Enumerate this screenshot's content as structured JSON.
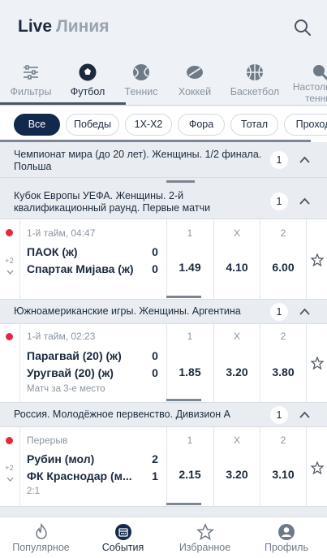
{
  "header": {
    "live_label": "Live",
    "line_label": "Линия",
    "search_icon": "search-icon"
  },
  "sports": [
    {
      "label": "Фильтры",
      "icon": "filters-icon"
    },
    {
      "label": "Футбол",
      "icon": "football-icon",
      "active": true
    },
    {
      "label": "Теннис",
      "icon": "tennis-icon"
    },
    {
      "label": "Хоккей",
      "icon": "hockey-icon"
    },
    {
      "label": "Баскетбол",
      "icon": "basketball-icon"
    },
    {
      "label": "Настольный теннис",
      "icon": "table-tennis-icon"
    }
  ],
  "filters": [
    "Все",
    "Победы",
    "1Х-Х2",
    "Фора",
    "Тотал",
    "Проход"
  ],
  "leagues": [
    {
      "name": "Чемпионат мира (до 20 лет). Женщины. 1/2 финала. Польша",
      "count": "1"
    },
    {
      "name": "Кубок Европы УЕФА. Женщины. 2-й квалификационный раунд. Первые матчи",
      "count": "1"
    },
    {
      "name": "Южноамериканские игры. Женщины. Аргентина",
      "count": "1"
    },
    {
      "name": "Россия. Молодёжное первенство. Дивизион А",
      "count": "1"
    }
  ],
  "odds_headers": [
    "1",
    "X",
    "2"
  ],
  "matches": [
    {
      "status": "1-й тайм, 04:47",
      "team1": "ПАОК (ж)",
      "score1": "0",
      "team2": "Спартак Мијава (ж)",
      "score2": "0",
      "more": "+2",
      "odds": [
        "1.49",
        "4.10",
        "6.00"
      ]
    },
    {
      "status": "1-й тайм, 02:23",
      "team1": "Парагвай (20) (ж)",
      "score1": "0",
      "team2": "Уругвай (20) (ж)",
      "score2": "0",
      "note": "Матч за 3-е место",
      "odds": [
        "1.85",
        "3.20",
        "3.80"
      ]
    },
    {
      "status": "Перерыв",
      "team1": "Рубин (мол)",
      "score1": "2",
      "team2": "ФК Краснодар (м...",
      "score2": "1",
      "note": "2:1",
      "more": "+2",
      "odds": [
        "2.15",
        "3.20",
        "3.10"
      ]
    }
  ],
  "bottom_nav": [
    {
      "label": "Популярное",
      "icon": "fire-icon"
    },
    {
      "label": "События",
      "icon": "calendar-icon",
      "active": true
    },
    {
      "label": "Избранное",
      "icon": "star-icon"
    },
    {
      "label": "Профиль",
      "icon": "profile-icon"
    }
  ],
  "colors": {
    "accent": "#13294b",
    "live": "#e3283f",
    "bg": "#e9edf2"
  }
}
